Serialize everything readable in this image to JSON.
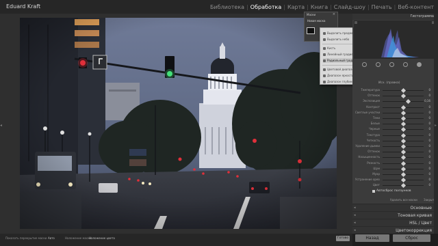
{
  "header": {
    "owner": "Eduard Kraft",
    "modules": [
      "Библиотека",
      "Обработка",
      "Карта",
      "Книга",
      "Слайд-шоу",
      "Печать",
      "Веб-контент"
    ],
    "active_module": "Обработка"
  },
  "floating_panel": {
    "title": "Маски",
    "new_mask": "Новая маска"
  },
  "mask_menu": {
    "items": [
      {
        "label": "Выделить предмет",
        "highlight": false
      },
      {
        "label": "Выделить небо",
        "highlight": false
      },
      {
        "label": "Кисть",
        "highlight": false
      },
      {
        "label": "Линейный градиент",
        "highlight": false
      },
      {
        "label": "Радиальный градиент",
        "highlight": true
      },
      {
        "label": "Цветовой диапазон",
        "highlight": false
      },
      {
        "label": "Диапазон яркости",
        "highlight": false
      },
      {
        "label": "Диапазон глубины",
        "highlight": false
      }
    ]
  },
  "right_panel": {
    "histogram_title": "Гистограмма",
    "section_title": "Исх. (правка)",
    "auto_label": "Автосброс ползунков",
    "reset_left": "Удалить все маски",
    "reset_right": "Закрыть",
    "accordions": [
      "Основные",
      "Тоновая кривая",
      "HSL / Цвет",
      "Цветокоррекция"
    ],
    "btn_prev": "Назад",
    "btn_reset": "Сброс"
  },
  "controls": [
    {
      "label": "Температура",
      "knob": 0.5,
      "value": "0"
    },
    {
      "label": "Оттенок",
      "knob": 0.5,
      "value": "0"
    },
    {
      "label": "Экспозиция",
      "knob": 0.62,
      "value": "0,16"
    },
    {
      "label": "Контраст",
      "knob": 0.5,
      "value": "0"
    },
    {
      "label": "Светлые участки",
      "knob": 0.5,
      "value": "0"
    },
    {
      "label": "Тени",
      "knob": 0.5,
      "value": "0"
    },
    {
      "label": "Белые",
      "knob": 0.5,
      "value": "0"
    },
    {
      "label": "Черные",
      "knob": 0.5,
      "value": "0"
    },
    {
      "label": "Текстура",
      "knob": 0.5,
      "value": "0"
    },
    {
      "label": "Четкость",
      "knob": 0.5,
      "value": "0"
    },
    {
      "label": "Удаление дымки",
      "knob": 0.5,
      "value": "0"
    },
    {
      "label": "Оттенок",
      "knob": 0.5,
      "value": "0"
    },
    {
      "label": "Насыщенность",
      "knob": 0.5,
      "value": "0"
    },
    {
      "label": "Резкость",
      "knob": 0.5,
      "value": "0"
    },
    {
      "label": "Шум",
      "knob": 0.5,
      "value": "0"
    },
    {
      "label": "Муар",
      "knob": 0.5,
      "value": "0"
    },
    {
      "label": "Устранение ореолов",
      "knob": 0.5,
      "value": "0"
    },
    {
      "label": "Цвет",
      "knob": 0.5,
      "value": "0"
    }
  ],
  "bottombar": {
    "overlay_label": "Показать перекрытие маски",
    "overlay_value": "Авто",
    "color_label": "Наложение маски:",
    "color_value": "Наложение цвета",
    "done": "Готово"
  },
  "colors": {
    "accent_red": "#e0303a",
    "accent_green": "#44e07a",
    "panel": "#3b3b3b",
    "workspace": "#2f2f2f"
  }
}
